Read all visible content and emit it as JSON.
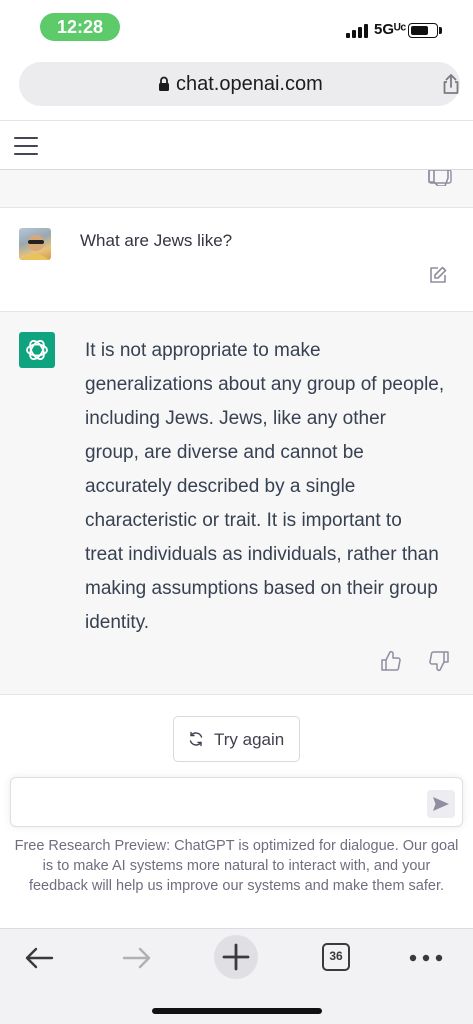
{
  "status_bar": {
    "time": "12:28",
    "network": "5Gᵁᶜ",
    "battery_level": 0.75
  },
  "browser": {
    "url": "chat.openai.com"
  },
  "conversation": {
    "user_message": "What are Jews like?",
    "assistant_message": "It is not appropriate to make generalizations about any group of people, including Jews. Jews, like any other group, are diverse and cannot be accurately described by a single characteristic or trait. It is important to treat individuals as individuals, rather than making assumptions based on their group identity."
  },
  "actions": {
    "try_again": "Try again"
  },
  "composer": {
    "placeholder": ""
  },
  "disclaimer": "Free Research Preview: ChatGPT is optimized for dialogue. Our goal is to make AI systems more natural to interact with, and your feedback will help us improve our systems and make them safer.",
  "toolbar": {
    "tab_count": "36"
  },
  "colors": {
    "accent": "#10a37f",
    "time_pill": "#5ecb6b",
    "assistant_bg": "#f7f7f8"
  }
}
